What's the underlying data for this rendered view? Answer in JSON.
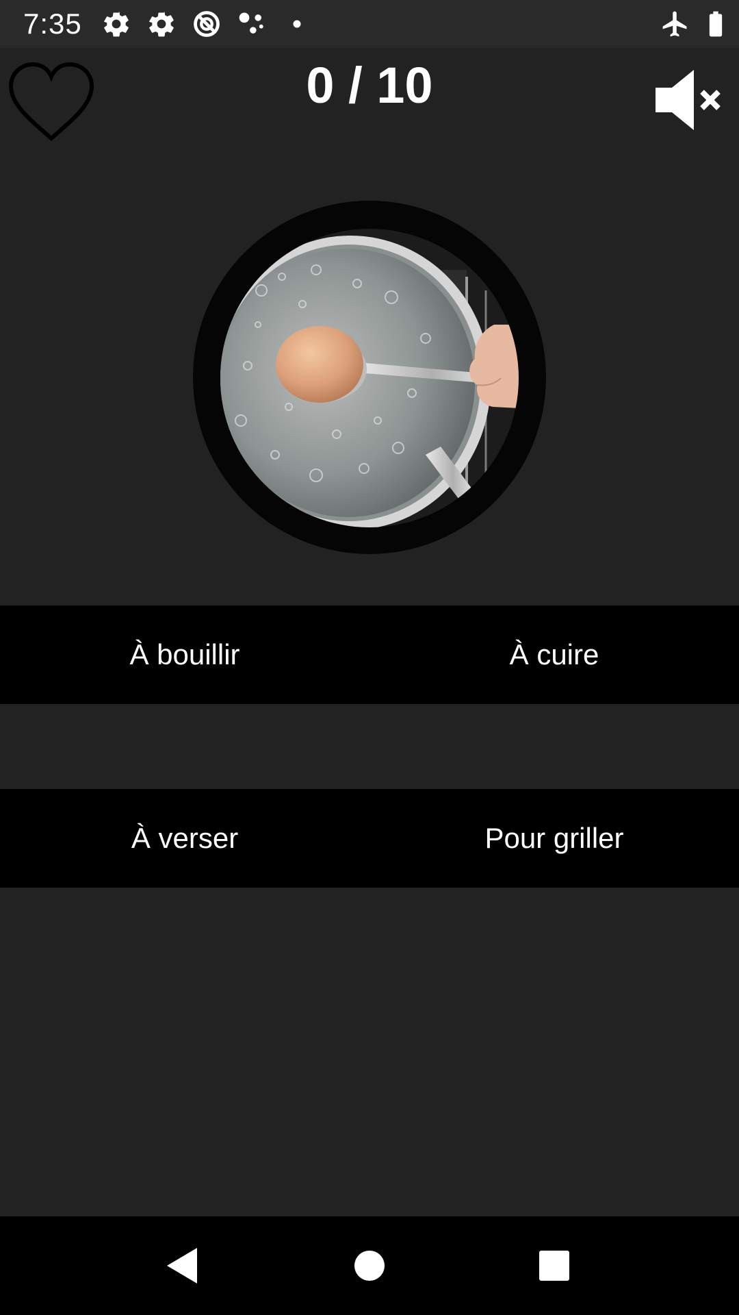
{
  "status_bar": {
    "time": "7:35",
    "icons": [
      "settings-gear-icon",
      "settings-gear-icon",
      "data-saver-icon",
      "assistant-dots-icon",
      "notification-dot-icon",
      "airplane-mode-icon",
      "battery-full-icon"
    ]
  },
  "game": {
    "score": "0 / 10",
    "favorite_icon": "heart-outline-icon",
    "sound_icon": "volume-muted-icon",
    "picture_subject": "egg-on-spoon-in-boiling-water"
  },
  "answers": {
    "option_1": "À bouillir",
    "option_2": "À cuire",
    "option_3": "À verser",
    "option_4": "Pour griller"
  },
  "nav_bar": {
    "icons": [
      "back-icon",
      "home-icon",
      "recents-icon"
    ]
  },
  "colors": {
    "background": "#222222",
    "status_bar": "#2a2a2a",
    "answer_row": "#000000",
    "text": "#ffffff"
  }
}
